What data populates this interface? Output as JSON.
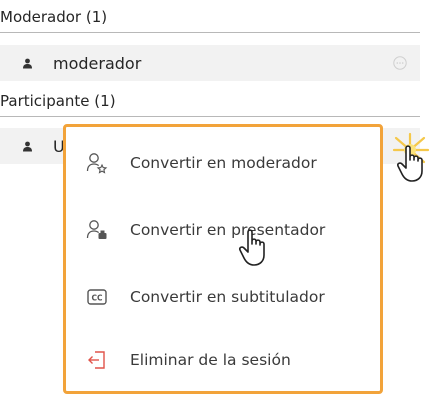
{
  "sections": {
    "moderator_header": "Moderador (1)",
    "participant_header": "Participante (1)"
  },
  "users": {
    "moderator_name": "moderador",
    "participant_name_partial": "U"
  },
  "context_menu": {
    "items": [
      {
        "label": "Convertir en moderador",
        "icon": "user-star-icon"
      },
      {
        "label": "Convertir en presentador",
        "icon": "user-presenter-icon"
      },
      {
        "label": "Convertir en subtitulador",
        "icon": "closed-caption-icon"
      },
      {
        "label": "Eliminar de la sesión",
        "icon": "exit-icon"
      }
    ]
  },
  "colors": {
    "highlight": "#f2a33a",
    "row_bg": "#f2f2f2",
    "remove_icon": "#e0534a"
  }
}
